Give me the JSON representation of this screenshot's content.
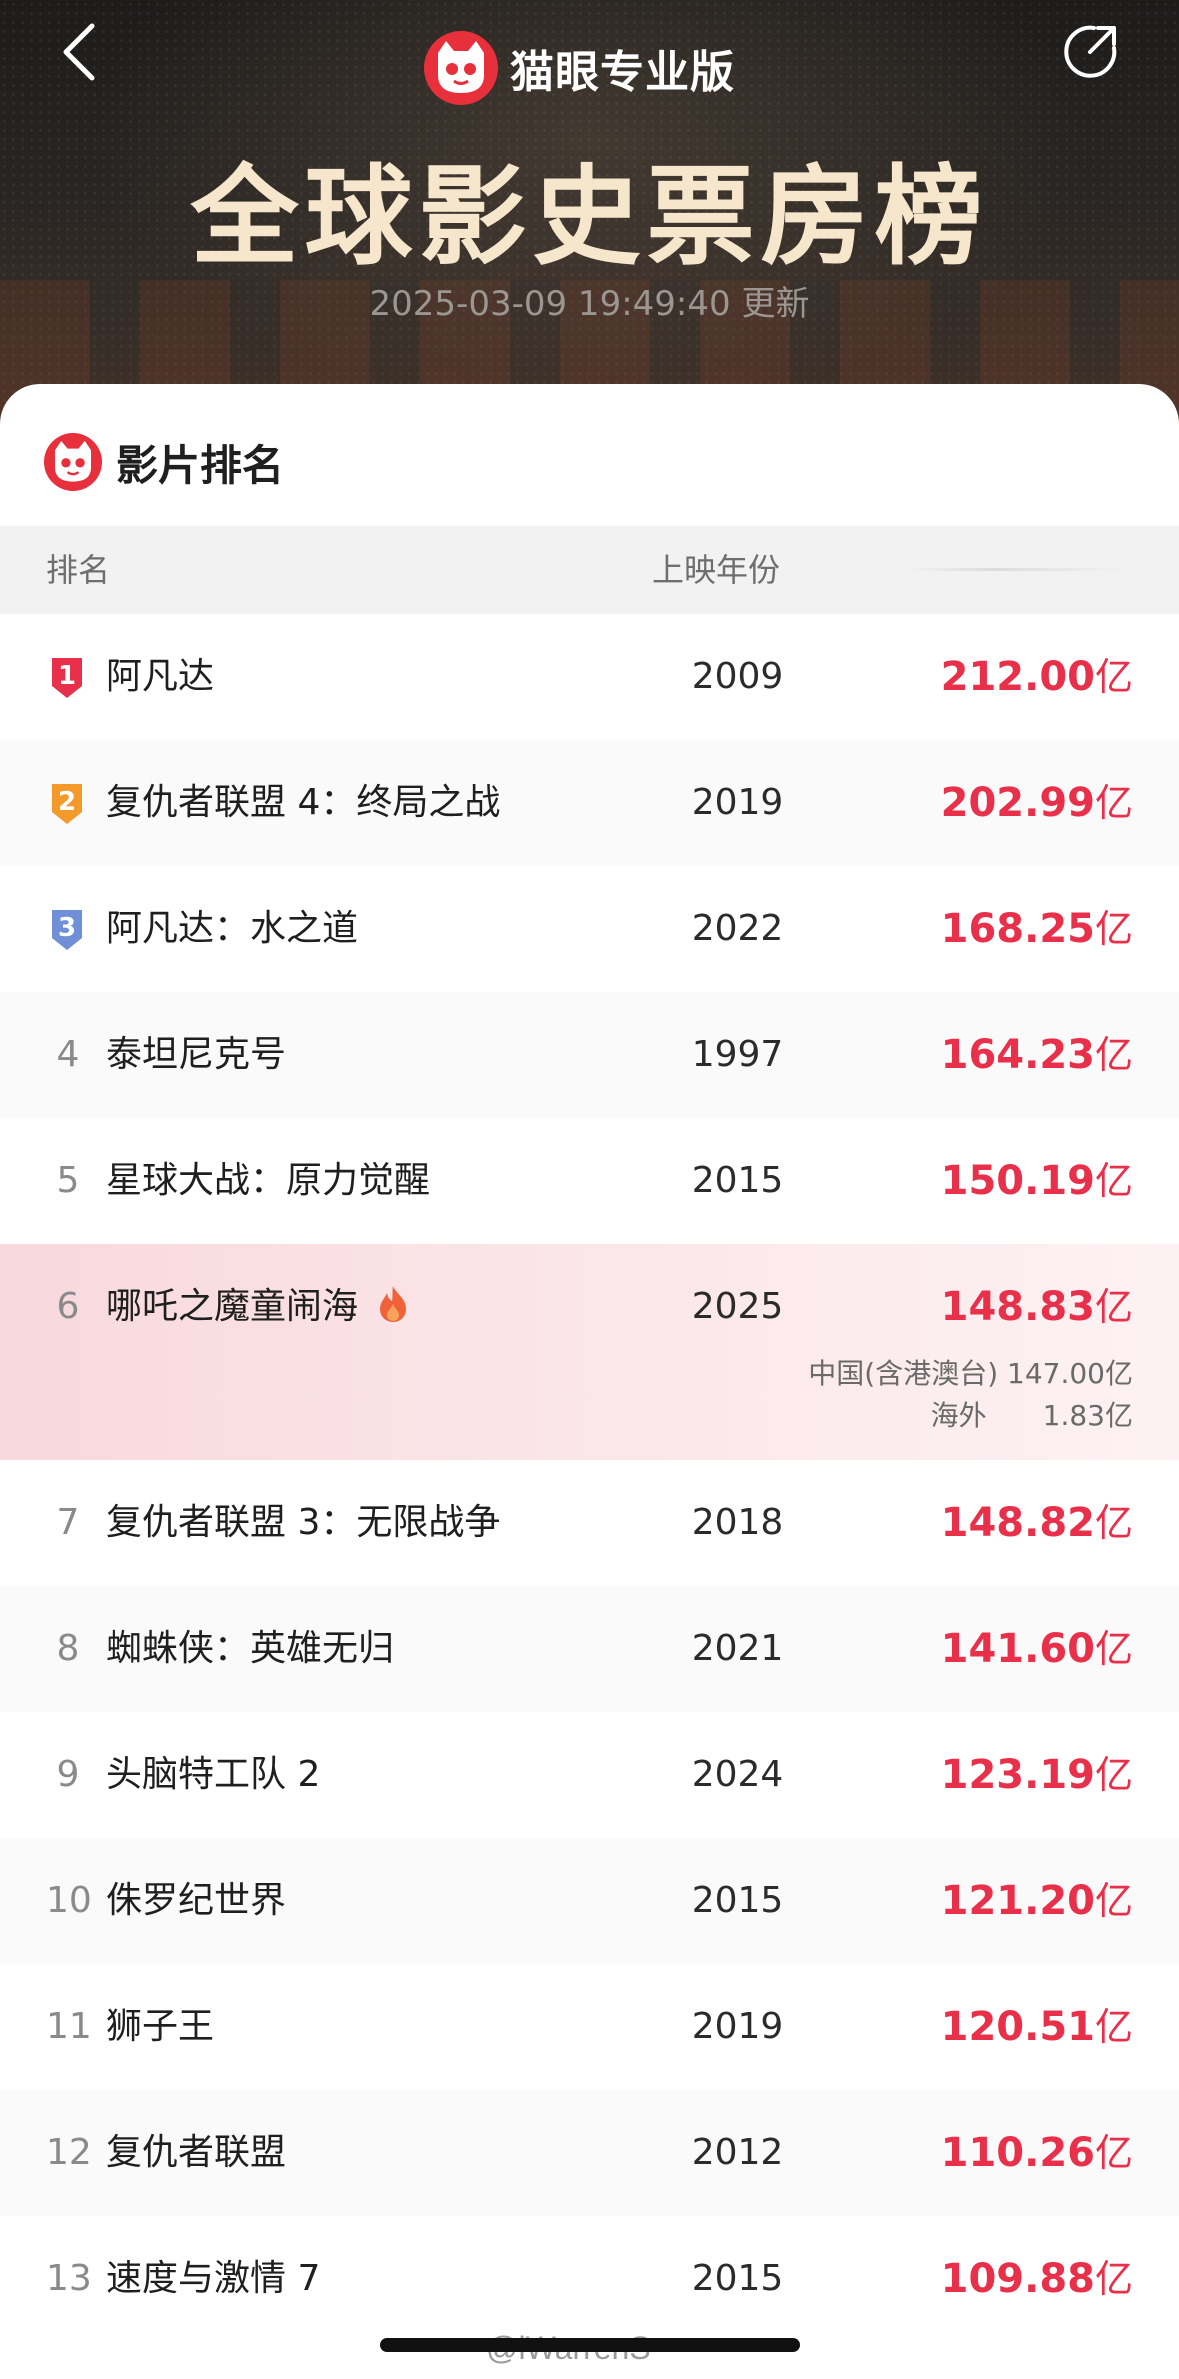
{
  "header": {
    "brand": "猫眼专业版",
    "title": "全球影史票房榜",
    "updated": "2025-03-09 19:49:40 更新",
    "back_icon": "chevron-left-icon",
    "share_icon": "share-icon"
  },
  "section": {
    "title": "影片排名"
  },
  "table": {
    "headers": {
      "rank": "排名",
      "year": "上映年份"
    },
    "rows": [
      {
        "rank": "1",
        "name": "阿凡达",
        "year": "2009",
        "gross": "212.00",
        "unit": "亿",
        "medal_color": "#e8304a"
      },
      {
        "rank": "2",
        "name": "复仇者联盟 4：终局之战",
        "year": "2019",
        "gross": "202.99",
        "unit": "亿",
        "medal_color": "#f39a2b"
      },
      {
        "rank": "3",
        "name": "阿凡达：水之道",
        "year": "2022",
        "gross": "168.25",
        "unit": "亿",
        "medal_color": "#6f8fd6"
      },
      {
        "rank": "4",
        "name": "泰坦尼克号",
        "year": "1997",
        "gross": "164.23",
        "unit": "亿"
      },
      {
        "rank": "5",
        "name": "星球大战：原力觉醒",
        "year": "2015",
        "gross": "150.19",
        "unit": "亿"
      },
      {
        "rank": "6",
        "name": "哪吒之魔童闹海",
        "year": "2025",
        "gross": "148.83",
        "unit": "亿",
        "detail_china": "中国(含港澳台) 147.00亿",
        "detail_overseas": "海外　　1.83亿",
        "hot": true
      },
      {
        "rank": "7",
        "name": "复仇者联盟 3：无限战争",
        "year": "2018",
        "gross": "148.82",
        "unit": "亿"
      },
      {
        "rank": "8",
        "name": "蜘蛛侠：英雄无归",
        "year": "2021",
        "gross": "141.60",
        "unit": "亿"
      },
      {
        "rank": "9",
        "name": "头脑特工队 2",
        "year": "2024",
        "gross": "123.19",
        "unit": "亿"
      },
      {
        "rank": "10",
        "name": "侏罗纪世界",
        "year": "2015",
        "gross": "121.20",
        "unit": "亿"
      },
      {
        "rank": "11",
        "name": "狮子王",
        "year": "2019",
        "gross": "120.51",
        "unit": "亿"
      },
      {
        "rank": "12",
        "name": "复仇者联盟",
        "year": "2012",
        "gross": "110.26",
        "unit": "亿"
      },
      {
        "rank": "13",
        "name": "速度与激情 7",
        "year": "2015",
        "gross": "109.88",
        "unit": "亿"
      }
    ]
  },
  "watermark": "@iWarrenS"
}
